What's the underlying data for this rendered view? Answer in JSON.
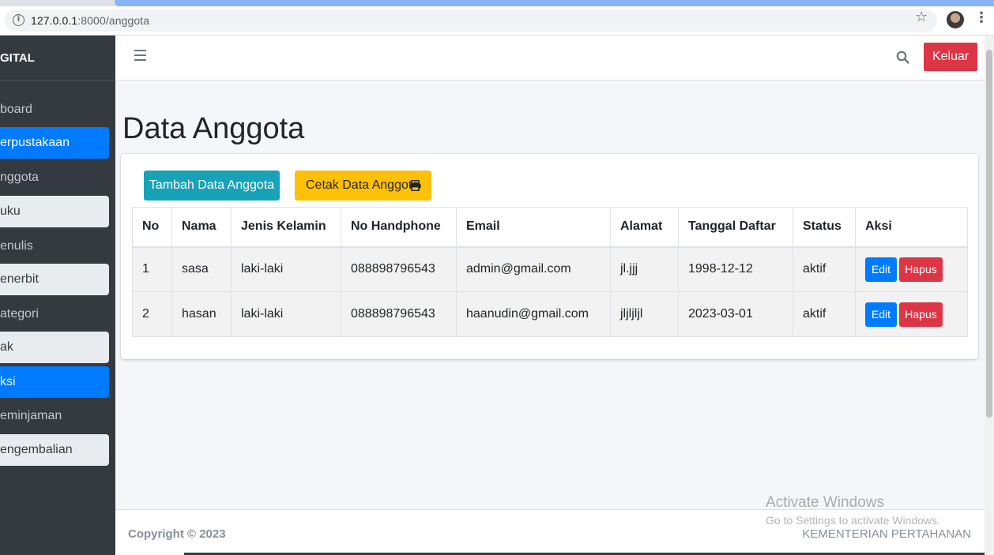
{
  "browser": {
    "url_host": "127.0.0.1",
    "url_path": ":8000/anggota"
  },
  "sidebar": {
    "brand": "GITAL",
    "items": [
      {
        "label": "board",
        "style": "plain"
      },
      {
        "label": "erpustakaan",
        "style": "active"
      },
      {
        "label": "nggota",
        "style": "plain"
      },
      {
        "label": "uku",
        "style": "light"
      },
      {
        "label": "enulis",
        "style": "plain"
      },
      {
        "label": "enerbit",
        "style": "light"
      },
      {
        "label": "ategori",
        "style": "plain"
      },
      {
        "label": "ak",
        "style": "light"
      },
      {
        "label": "ksi",
        "style": "active"
      },
      {
        "label": "eminjaman",
        "style": "plain"
      },
      {
        "label": "engembalian",
        "style": "light"
      }
    ]
  },
  "topbar": {
    "logout_label": "Keluar"
  },
  "main": {
    "title": "Data Anggota",
    "add_button": "Tambah Data Anggota",
    "print_button": "Cetak Data Anggota",
    "table": {
      "headers": [
        "No",
        "Nama",
        "Jenis Kelamin",
        "No Handphone",
        "Email",
        "Alamat",
        "Tanggal Daftar",
        "Status",
        "Aksi"
      ],
      "rows": [
        {
          "no": "1",
          "nama": "sasa",
          "jenis_kelamin": "laki-laki",
          "no_hp": "088898796543",
          "email": "admin@gmail.com",
          "alamat": "jl.jjj",
          "tanggal": "1998-12-12",
          "status": "aktif"
        },
        {
          "no": "2",
          "nama": "hasan",
          "jenis_kelamin": "laki-laki",
          "no_hp": "088898796543",
          "email": "haanudin@gmail.com",
          "alamat": "jljljljl",
          "tanggal": "2023-03-01",
          "status": "aktif"
        }
      ],
      "edit_label": "Edit",
      "delete_label": "Hapus"
    }
  },
  "footer": {
    "copyright": "Copyright © 2023",
    "org": "KEMENTERIAN PERTAHANAN"
  },
  "watermark": {
    "title": "Activate Windows",
    "subtitle": "Go to Settings to activate Windows."
  },
  "colors": {
    "sidebar_bg": "#343a40",
    "active": "#007bff",
    "danger": "#dc3545",
    "info": "#17a2b8",
    "warning": "#ffc107"
  },
  "icons": [
    "info-icon",
    "star-icon",
    "avatar",
    "kebab-icon",
    "menu-icon",
    "search-icon",
    "print-icon"
  ]
}
